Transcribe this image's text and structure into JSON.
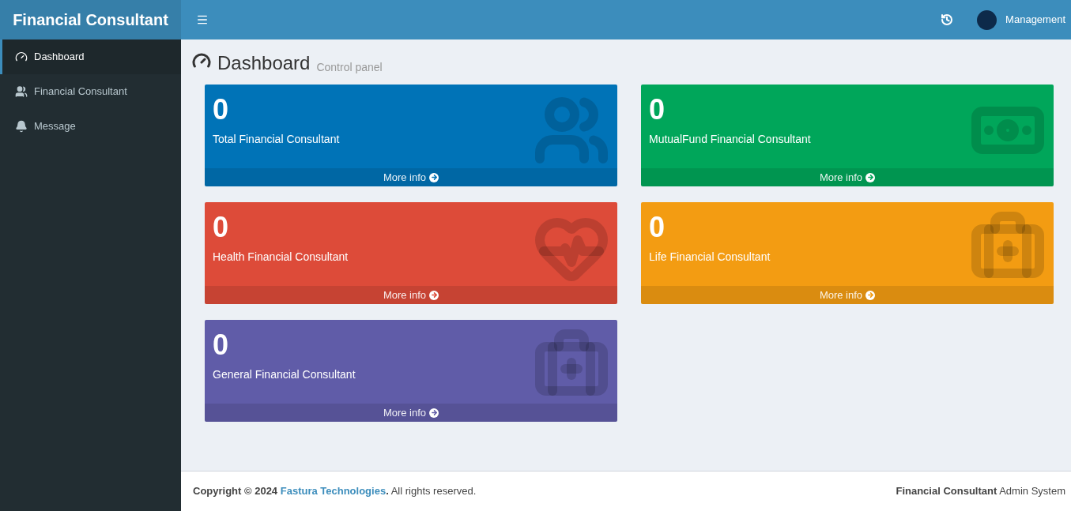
{
  "brand": "Financial Consultant",
  "header": {
    "user": "Management"
  },
  "sidebar": {
    "items": [
      {
        "label": "Dashboard",
        "kind": "gauge",
        "selected": true
      },
      {
        "label": "Financial Consultant",
        "kind": "users",
        "selected": false
      },
      {
        "label": "Message",
        "kind": "bell",
        "selected": false
      }
    ]
  },
  "page": {
    "title": "Dashboard",
    "subtitle": "Control panel"
  },
  "cards": [
    {
      "count": "0",
      "label": "Total Financial Consultant",
      "link": "More info",
      "kind": "users",
      "color": "#0073b7"
    },
    {
      "count": "0",
      "label": "MutualFund Financial Consultant",
      "link": "More info",
      "kind": "money",
      "color": "#00a65a"
    },
    {
      "count": "0",
      "label": "Health Financial Consultant",
      "link": "More info",
      "kind": "heart",
      "color": "#dd4b39"
    },
    {
      "count": "0",
      "label": "Life Financial Consultant",
      "link": "More info",
      "kind": "medkit",
      "color": "#f39c12"
    },
    {
      "count": "0",
      "label": "General Financial Consultant",
      "link": "More info",
      "kind": "medkit",
      "color": "#605ca8"
    }
  ],
  "footer": {
    "left_prefix": "**Copyright © 2024**",
    "left_link": "Fastura Technologies",
    "left_suffix": "**.** All rights reserved.",
    "right": "**Financial Consultant** Admin System"
  }
}
